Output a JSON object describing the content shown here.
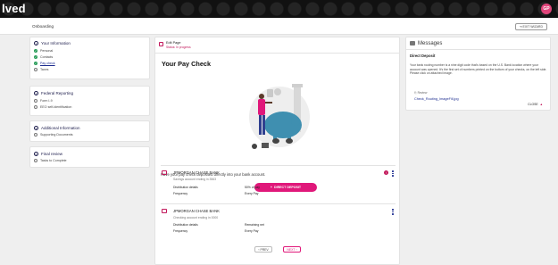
{
  "app": {
    "logo": "lved",
    "avatar_initials": "GP",
    "page_title": "Onboarding",
    "exit_label": "EXIT WIZARD"
  },
  "sidebar": {
    "sections": [
      {
        "number": "1",
        "title": "Your Information",
        "items": [
          {
            "label": "Personal",
            "state": "done"
          },
          {
            "label": "Contacts",
            "state": "done"
          },
          {
            "label": "Pay check",
            "state": "current"
          },
          {
            "label": "Taxes",
            "state": "todo"
          }
        ]
      },
      {
        "number": "2",
        "title": "Federal Reporting",
        "items": [
          {
            "label": "Form I-9",
            "state": "todo"
          },
          {
            "label": "EEO self-identification",
            "state": "todo"
          }
        ]
      },
      {
        "number": "3",
        "title": "Additional Information",
        "items": [
          {
            "label": "Supporting Documents",
            "state": "todo"
          }
        ]
      },
      {
        "number": "4",
        "title": "Final review",
        "items": [
          {
            "label": "Tasks to Complete",
            "state": "todo"
          }
        ]
      }
    ]
  },
  "main": {
    "header_title": "Edit Page",
    "header_status": "Status: In progress",
    "page_heading": "Your Pay Check",
    "description": "Have your pay check deposited directly into your bank account.",
    "direct_deposit_label": "DIRECT DEPOSIT",
    "accounts": [
      {
        "bank": "JPMORGAN CHASE BANK",
        "sub": "Savings account ending in 3563",
        "rows": [
          {
            "label": "Distribution details",
            "value": "50% of pay"
          },
          {
            "label": "Frequency",
            "value": "Every Pay"
          }
        ],
        "alert": "!"
      },
      {
        "bank": "JPMORGAN CHASE BANK",
        "sub": "Checking account ending in 0000",
        "rows": [
          {
            "label": "Distribution details",
            "value": "Remaining net"
          },
          {
            "label": "Frequency",
            "value": "Every Pay"
          }
        ]
      }
    ],
    "prev_label": "PREV",
    "next_label": "NEXT"
  },
  "messages": {
    "header": "Messages",
    "title": "Direct Deposit",
    "body": "Your bank routing number is a nine digit code that's based on the U.S. Bank location where your account was opened. It's the first set of numbers printed on the bottom of your checks, on the left side. Please click on attached image.",
    "review_label": "Review",
    "file_link": "Check_Routing_ImageFill.jpg",
    "close_label": "CLOSE"
  },
  "colors": {
    "accent": "#e0187a",
    "nav": "#1b2b8f",
    "success": "#2a9d5a"
  }
}
